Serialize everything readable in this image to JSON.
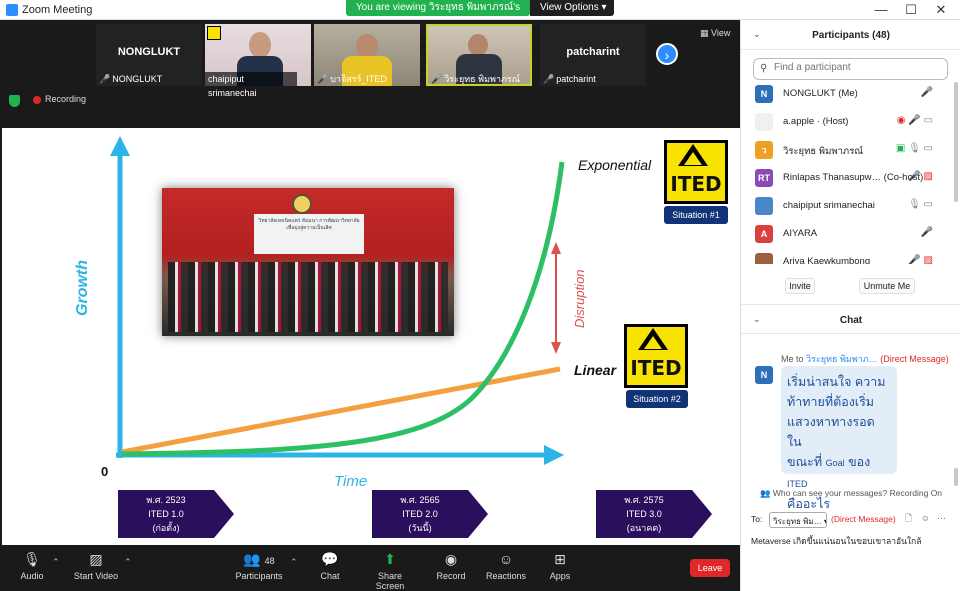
{
  "window": {
    "title": "Zoom Meeting",
    "viewing_banner": "You are viewing วิระยุทธ พิมพาภรณ์'s screen",
    "view_options": "View Options ▾",
    "controls": {
      "minimize": "—",
      "maximize": "☐",
      "close": "✕"
    }
  },
  "strip": {
    "tiles": [
      {
        "name": "NONGLUKT",
        "caption": "NONGLUKT",
        "muted": true,
        "video": false
      },
      {
        "name": "",
        "caption": "chaipiput srimanechai",
        "muted": false,
        "video": true
      },
      {
        "name": "",
        "caption": "บาจิสรร์_ITED",
        "muted": true,
        "video": true
      },
      {
        "name": "",
        "caption": "วิระยุทธ พิมพาภรณ์",
        "muted": true,
        "video": true
      },
      {
        "name": "patcharint",
        "caption": "patcharint",
        "muted": true,
        "video": false
      }
    ],
    "view_label": "View",
    "recording_label": "Recording"
  },
  "slide": {
    "label_exponential": "Exponential",
    "label_linear": "Linear",
    "label_growth": "Growth",
    "label_disruption": "Disruption",
    "label_time": "Time",
    "label_zero": "0",
    "ited_text": "ITED",
    "situation_1": "Situation #1",
    "situation_2": "Situation #2",
    "photo_banner": "วิทยาลัยเทคนิคแพร่ สัมมนา การพัฒนาวิทยาลัย เพื่อมุ่งสู่ความเป็นเลิศ",
    "eras": [
      {
        "line1": "พ.ศ. 2523",
        "line2": "ITED 1.0",
        "line3": "(ก่อตั้ง)"
      },
      {
        "line1": "พ.ศ. 2565",
        "line2": "ITED 2.0",
        "line3": "(วันนี้)"
      },
      {
        "line1": "พ.ศ. 2575",
        "line2": "ITED 3.0",
        "line3": "(อนาคต)"
      }
    ],
    "colors": {
      "axis": "#2bb4e6",
      "exponential": "#2dbf63",
      "linear": "#f5a040",
      "disruption": "#d9534f"
    }
  },
  "toolbar": {
    "audio": "Audio",
    "start_video": "Start Video",
    "participants": "Participants",
    "participants_count": "48",
    "chat": "Chat",
    "share_screen": "Share Screen",
    "record": "Record",
    "reactions": "Reactions",
    "apps": "Apps",
    "leave": "Leave"
  },
  "participants_panel": {
    "title": "Participants (48)",
    "search_placeholder": "Find a participant",
    "rows": [
      {
        "initials": "N",
        "color": "#2d6fb8",
        "name": "NONGLUKT (Me)",
        "icons": "mic-muted"
      },
      {
        "initials": "",
        "color": "#f0f0f0",
        "name": "a.apple · (Host)",
        "icons": "rec-muted-video"
      },
      {
        "initials": "ว",
        "color": "#f0a020",
        "name": "วิระยุทธ พิมพาภรณ์",
        "icons": "share-mic-video"
      },
      {
        "initials": "RT",
        "color": "#8b4ab4",
        "name": "Rinlapas Thanasupw… (Co-host)",
        "icons": "muted-video-off"
      },
      {
        "initials": "",
        "color": "#4a86c8",
        "name": "chaipiput srimanechai",
        "icons": "mic-video"
      },
      {
        "initials": "A",
        "color": "#d94040",
        "name": "AIYARA",
        "icons": "muted"
      },
      {
        "initials": "",
        "color": "#a06040",
        "name": "Ariya Kaewkumbong",
        "icons": "muted-video-off"
      }
    ],
    "invite": "Invite",
    "unmute_me": "Unmute Me"
  },
  "chat_panel": {
    "title": "Chat",
    "msg_meta_prefix": "Me to",
    "msg_meta_to": "วิระยุทธ พิมพาภ…",
    "msg_meta_dm": "(Direct Message)",
    "msg_avatar": "N",
    "msg_line1": "เริ่มน่าสนใจ ความ",
    "msg_line2": "ท้าทายที่ต้องเริ่ม",
    "msg_line3": "แสวงหาทางรอด ใน",
    "msg_line4a": "ขณะที่",
    "msg_line4b": "Goal",
    "msg_line4c": "ของ",
    "msg_line4d": "ITED",
    "msg_line5": "คืออะไร",
    "who_can_see": "Who can see your messages? Recording On",
    "to_label": "To:",
    "to_value": "วิระยุทธ พิม… ▾",
    "to_dm": "(Direct Message)",
    "compose_text": "Metaverse เกิดขึ้นแน่นอนในขอบเขาลาอันใกล้"
  }
}
